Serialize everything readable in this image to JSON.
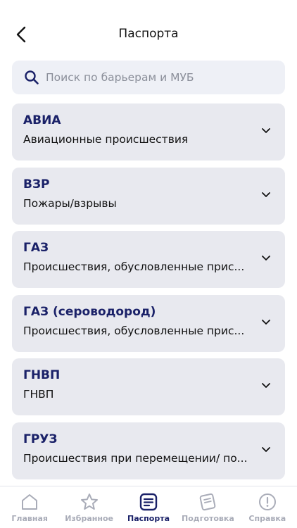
{
  "header": {
    "title": "Паспорта",
    "back_icon": "chevron-left-icon"
  },
  "search": {
    "placeholder": "Поиск по барьерам и МУБ",
    "value": "",
    "icon": "search-icon"
  },
  "cards": [
    {
      "code": "АВИА",
      "description": "Авиационные происшествия"
    },
    {
      "code": "ВЗР",
      "description": "Пожары/взрывы"
    },
    {
      "code": "ГАЗ",
      "description": "Происшествия, обусловленные прис..."
    },
    {
      "code": "ГАЗ (сероводород)",
      "description": "Происшествия, обусловленные  прис..."
    },
    {
      "code": "ГНВП",
      "description": "ГНВП"
    },
    {
      "code": "ГРУЗ",
      "description": "Происшествия при перемещении/ по..."
    }
  ],
  "tabbar": {
    "items": [
      {
        "label": "Главная",
        "icon": "home-icon",
        "active": false
      },
      {
        "label": "Избранное",
        "icon": "star-icon",
        "active": false
      },
      {
        "label": "Паспорта",
        "icon": "passport-list-icon",
        "active": true
      },
      {
        "label": "Подготовка",
        "icon": "training-icon",
        "active": false
      },
      {
        "label": "Справка",
        "icon": "info-icon",
        "active": false
      }
    ]
  },
  "colors": {
    "accent": "#1a2168",
    "card_bg": "#e8e9ef",
    "search_bg": "#eef0f6",
    "inactive": "#a9acb8"
  }
}
